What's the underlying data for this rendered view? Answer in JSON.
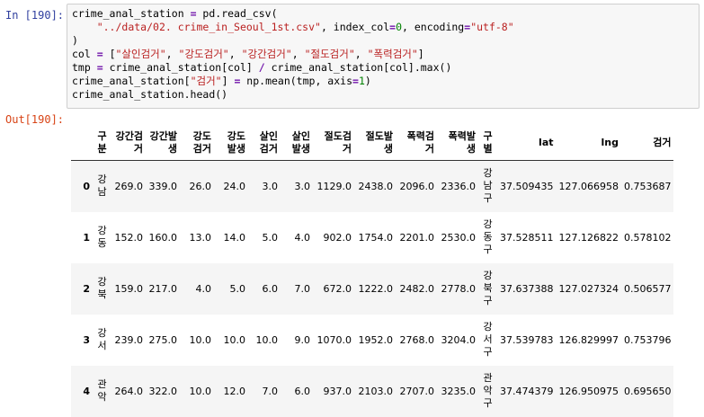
{
  "notebook": {
    "in_prompt": "In [190]:",
    "out_prompt": "Out[190]:",
    "code": {
      "line1_a": "crime_anal_station ",
      "line1_op": "=",
      "line1_b": " pd.read_csv(",
      "line2_indent": "    ",
      "line2_str": "\"../data/02. crime_in_Seoul_1st.csv\"",
      "line2_b": ", index_col",
      "line2_op": "=",
      "line2_num": "0",
      "line2_c": ", encoding",
      "line2_op2": "=",
      "line2_str2": "\"utf-8\"",
      "line3": ")",
      "line4_a": "col ",
      "line4_op": "=",
      "line4_b": " [",
      "line4_s1": "\"살인검거\"",
      "line4_s2": "\"강도검거\"",
      "line4_s3": "\"강간검거\"",
      "line4_s4": "\"절도검거\"",
      "line4_s5": "\"폭력검거\"",
      "line4_sep": ", ",
      "line4_end": "]",
      "line5_a": "tmp ",
      "line5_op": "=",
      "line5_b": " crime_anal_station[col] ",
      "line5_op2": "/",
      "line5_c": " crime_anal_station[col].max()",
      "line6_a": "crime_anal_station[",
      "line6_str": "\"검거\"",
      "line6_b": "] ",
      "line6_op": "=",
      "line6_c": " np.mean(tmp, axis",
      "line6_op2": "=",
      "line6_num": "1",
      "line6_d": ")",
      "line7": "crime_anal_station.head()"
    }
  },
  "table": {
    "columns": [
      "구분",
      "강간검거",
      "강간발생",
      "강도검거",
      "강도발생",
      "살인검거",
      "살인발생",
      "절도검거",
      "절도발생",
      "폭력검거",
      "폭력발생",
      "구별",
      "lat",
      "lng",
      "검거"
    ],
    "rows": [
      {
        "index": "0",
        "cells": [
          "강남",
          "269.0",
          "339.0",
          "26.0",
          "24.0",
          "3.0",
          "3.0",
          "1129.0",
          "2438.0",
          "2096.0",
          "2336.0",
          "강남구",
          "37.509435",
          "127.066958",
          "0.753687"
        ]
      },
      {
        "index": "1",
        "cells": [
          "강동",
          "152.0",
          "160.0",
          "13.0",
          "14.0",
          "5.0",
          "4.0",
          "902.0",
          "1754.0",
          "2201.0",
          "2530.0",
          "강동구",
          "37.528511",
          "127.126822",
          "0.578102"
        ]
      },
      {
        "index": "2",
        "cells": [
          "강북",
          "159.0",
          "217.0",
          "4.0",
          "5.0",
          "6.0",
          "7.0",
          "672.0",
          "1222.0",
          "2482.0",
          "2778.0",
          "강북구",
          "37.637388",
          "127.027324",
          "0.506577"
        ]
      },
      {
        "index": "3",
        "cells": [
          "강서",
          "239.0",
          "275.0",
          "10.0",
          "10.0",
          "10.0",
          "9.0",
          "1070.0",
          "1952.0",
          "2768.0",
          "3204.0",
          "강서구",
          "37.539783",
          "126.829997",
          "0.753796"
        ]
      },
      {
        "index": "4",
        "cells": [
          "관악",
          "264.0",
          "322.0",
          "10.0",
          "12.0",
          "7.0",
          "6.0",
          "937.0",
          "2103.0",
          "2707.0",
          "3235.0",
          "관악구",
          "37.474379",
          "126.950975",
          "0.695650"
        ]
      }
    ]
  }
}
